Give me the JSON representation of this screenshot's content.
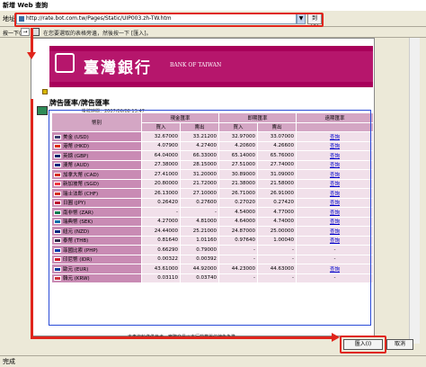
{
  "window": {
    "title": "新增 Web 查詢"
  },
  "address": {
    "label": "地址(D):",
    "url": "http://rate.bot.com.tw/Pages/Static/UIP003.zh-TW.htm",
    "go_label": "到(G)"
  },
  "toolbar": {
    "label": "按一下(",
    "hint": "在您要選取的表格旁邊，然後按一下 [匯入]。"
  },
  "bank": {
    "name_cn": "臺灣銀行",
    "name_en": "BANK OF TAIWAN"
  },
  "page": {
    "section_title": "牌告匯率/牌告匯率",
    "time_text": "掛牌時間：2007/06/08 13:47"
  },
  "table": {
    "headers": {
      "currency": "幣別",
      "cash": "現金匯率",
      "spot": "即期匯率",
      "forward": "遠期匯率",
      "history": "歷史匯率"
    },
    "subheaders": {
      "buy1": "買入",
      "sell1": "賣出",
      "buy2": "買入",
      "sell2": "賣出"
    },
    "rows": [
      {
        "currency": "美金 (USD)",
        "cash_buy": "32.67000",
        "cash_sell": "33.21200",
        "spot_buy": "32.97000",
        "spot_sell": "33.07000",
        "forward": "查詢",
        "flag_color": "#3c3b6e"
      },
      {
        "currency": "港幣 (HKD)",
        "cash_buy": "4.07900",
        "cash_sell": "4.27400",
        "spot_buy": "4.20600",
        "spot_sell": "4.26600",
        "forward": "查詢",
        "flag_color": "#de2910"
      },
      {
        "currency": "英鎊 (GBP)",
        "cash_buy": "64.04000",
        "cash_sell": "66.33000",
        "spot_buy": "65.14000",
        "spot_sell": "65.76000",
        "forward": "查詢",
        "flag_color": "#012169"
      },
      {
        "currency": "澳幣 (AUD)",
        "cash_buy": "27.38000",
        "cash_sell": "28.15000",
        "spot_buy": "27.51000",
        "spot_sell": "27.74000",
        "forward": "查詢",
        "flag_color": "#00247d"
      },
      {
        "currency": "加拿大幣 (CAD)",
        "cash_buy": "27.41000",
        "cash_sell": "31.20000",
        "spot_buy": "30.89000",
        "spot_sell": "31.09000",
        "forward": "查詢",
        "flag_color": "#d52b1e"
      },
      {
        "currency": "新加坡幣 (SGD)",
        "cash_buy": "20.80000",
        "cash_sell": "21.72000",
        "spot_buy": "21.38000",
        "spot_sell": "21.58000",
        "forward": "查詢",
        "flag_color": "#ef3340"
      },
      {
        "currency": "瑞士法郎 (CHF)",
        "cash_buy": "26.13000",
        "cash_sell": "27.10000",
        "spot_buy": "26.71000",
        "spot_sell": "26.91000",
        "forward": "查詢",
        "flag_color": "#d52b1e"
      },
      {
        "currency": "日圓 (JPY)",
        "cash_buy": "0.26420",
        "cash_sell": "0.27600",
        "spot_buy": "0.27020",
        "spot_sell": "0.27420",
        "forward": "查詢",
        "flag_color": "#bc002d"
      },
      {
        "currency": "南非幣 (ZAR)",
        "cash_buy": "-",
        "cash_sell": "-",
        "spot_buy": "4.54000",
        "spot_sell": "4.77000",
        "forward": "查詢",
        "flag_color": "#007a4d"
      },
      {
        "currency": "瑞典幣 (SEK)",
        "cash_buy": "4.27000",
        "cash_sell": "4.81000",
        "spot_buy": "4.64000",
        "spot_sell": "4.74000",
        "forward": "查詢",
        "flag_color": "#006aa7"
      },
      {
        "currency": "紐元 (NZD)",
        "cash_buy": "24.44000",
        "cash_sell": "25.21000",
        "spot_buy": "24.87000",
        "spot_sell": "25.00000",
        "forward": "查詢",
        "flag_color": "#00247d"
      },
      {
        "currency": "泰幣 (THB)",
        "cash_buy": "0.81640",
        "cash_sell": "1.01160",
        "spot_buy": "0.97640",
        "spot_sell": "1.00040",
        "forward": "查詢",
        "flag_color": "#2d2a4a"
      },
      {
        "currency": "菲國比索 (PHP)",
        "cash_buy": "0.66290",
        "cash_sell": "0.79000",
        "spot_buy": "-",
        "spot_sell": "-",
        "forward": "-",
        "flag_color": "#0038a8"
      },
      {
        "currency": "印尼幣 (IDR)",
        "cash_buy": "0.00322",
        "cash_sell": "0.00392",
        "spot_buy": "-",
        "spot_sell": "-",
        "forward": "-",
        "flag_color": "#ce1126"
      },
      {
        "currency": "歐元 (EUR)",
        "cash_buy": "43.61000",
        "cash_sell": "44.92000",
        "spot_buy": "44.23000",
        "spot_sell": "44.63000",
        "forward": "查詢",
        "flag_color": "#003399"
      },
      {
        "currency": "韓元 (KRW)",
        "cash_buy": "0.03110",
        "cash_sell": "0.03740",
        "spot_buy": "-",
        "spot_sell": "-",
        "forward": "-",
        "flag_color": "#cd2e3a"
      }
    ]
  },
  "footer": {
    "note": "本表資料僅供參考，實際交易以本行營業單位牌告為準。"
  },
  "buttons": {
    "import": "匯入(I)",
    "cancel": "取消"
  },
  "status": {
    "text": "完成"
  },
  "colors": {
    "highlight": "#e0251c",
    "banner": "#b6166c",
    "table_header": "#d4a6c4",
    "table_cell": "#f1e0ea"
  }
}
